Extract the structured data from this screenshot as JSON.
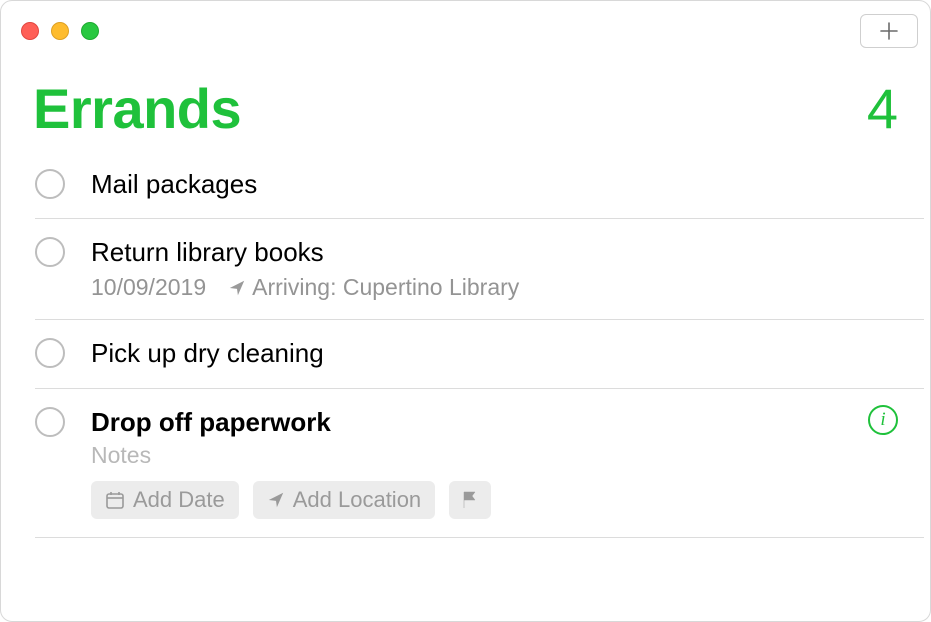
{
  "accent_color": "#1fc13b",
  "header": {
    "title": "Errands",
    "count": "4"
  },
  "toolbar": {
    "add_label": "+"
  },
  "items": [
    {
      "title": "Mail packages"
    },
    {
      "title": "Return library books",
      "date": "10/09/2019",
      "location_label": "Arriving: Cupertino Library"
    },
    {
      "title": "Pick up dry cleaning"
    },
    {
      "title": "Drop off paperwork",
      "notes_placeholder": "Notes",
      "chips": {
        "add_date": "Add Date",
        "add_location": "Add Location"
      },
      "selected": true
    }
  ]
}
